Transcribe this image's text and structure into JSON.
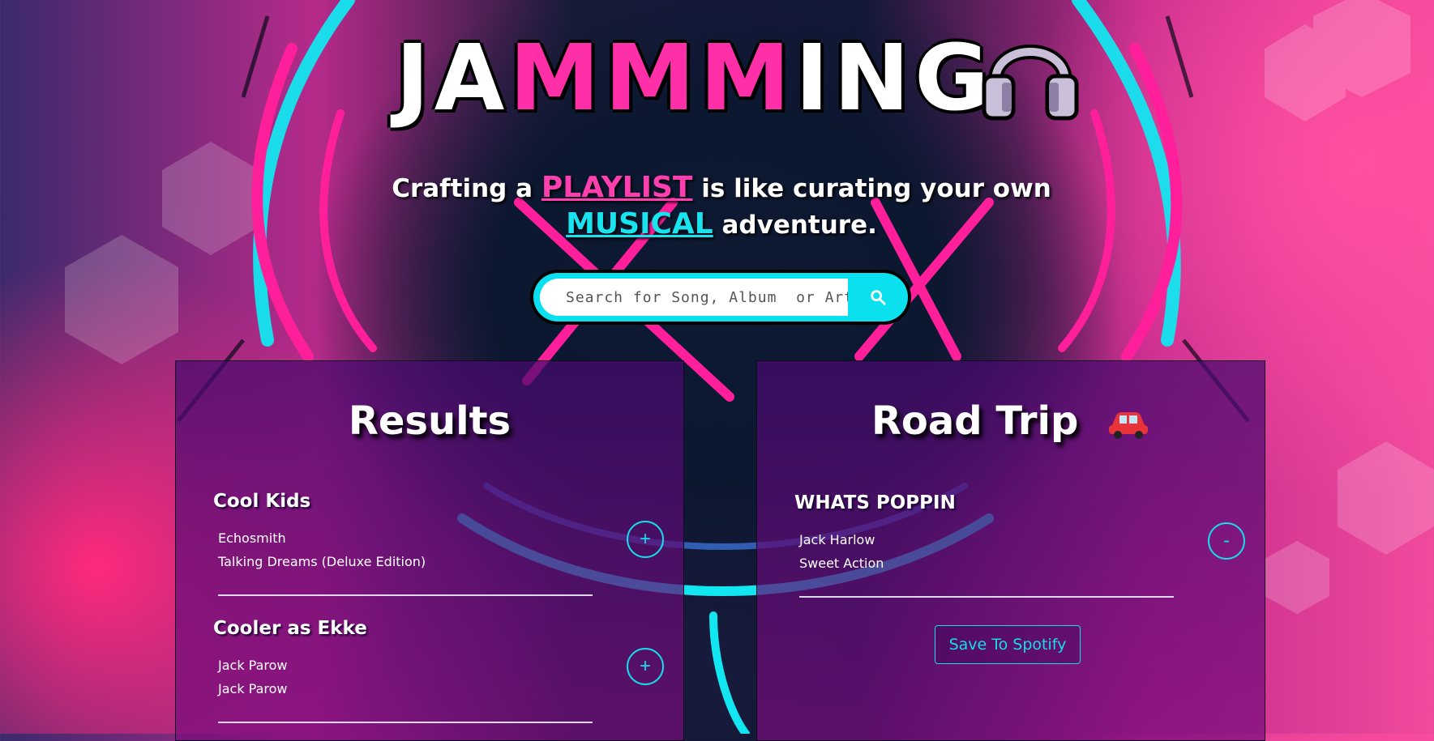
{
  "app": {
    "logo_parts": [
      "JA",
      "MMM",
      "ING"
    ],
    "tagline": {
      "part1": "Crafting a ",
      "highlight1": "PLAYLIST",
      "part2": " is like curating your own ",
      "highlight2": "MUSICAL",
      "part3": " adventure."
    }
  },
  "search": {
    "placeholder": "Search for Song, Album  or Artist",
    "icon": "search-icon"
  },
  "results": {
    "title": "Results",
    "tracks": [
      {
        "name": "Cool Kids",
        "artist": "Echosmith",
        "album": "Talking Dreams (Deluxe Edition)",
        "action": "+"
      },
      {
        "name": "Cooler as Ekke",
        "artist": "Jack Parow",
        "album": "Jack Parow",
        "action": "+"
      }
    ]
  },
  "playlist": {
    "title": "Road Trip",
    "title_icon": "car-icon",
    "tracks": [
      {
        "name": "WHATS POPPIN",
        "artist": "Jack Harlow",
        "album": "Sweet Action",
        "action": "-"
      }
    ],
    "save_label": "Save To Spotify"
  },
  "colors": {
    "accent_cyan": "#0ae0ee",
    "accent_pink": "#ff2fa8",
    "panel": "#5a0c7a"
  }
}
